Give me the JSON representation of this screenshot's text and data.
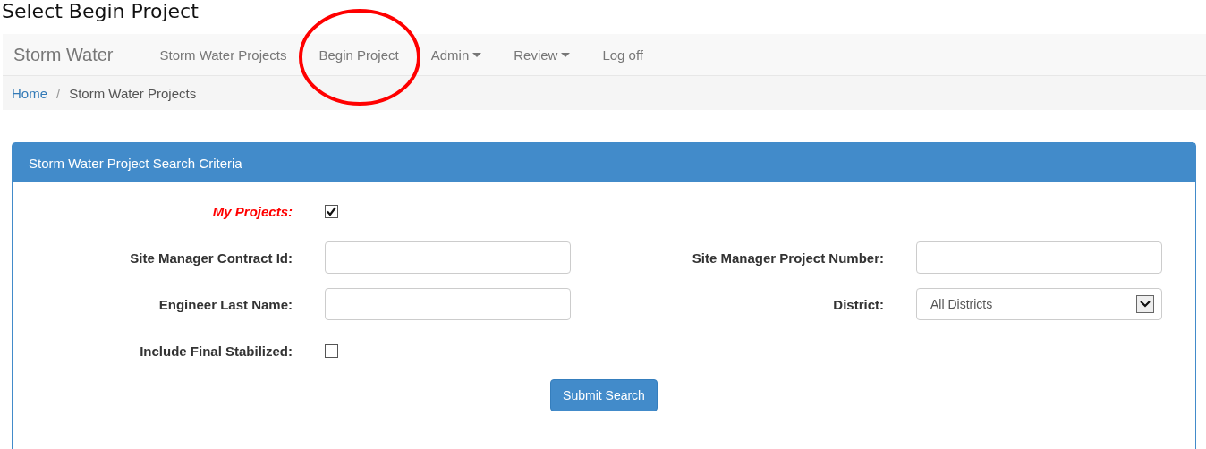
{
  "caption": "Select Begin Project",
  "navbar": {
    "brand": "Storm Water",
    "items": [
      {
        "label": "Storm Water Projects",
        "dropdown": false,
        "circled": false
      },
      {
        "label": "Begin Project",
        "dropdown": false,
        "circled": true
      },
      {
        "label": "Admin",
        "dropdown": true,
        "circled": false
      },
      {
        "label": "Review",
        "dropdown": true,
        "circled": false
      },
      {
        "label": "Log off",
        "dropdown": false,
        "circled": false
      }
    ]
  },
  "breadcrumb": {
    "separator": "/",
    "items": [
      {
        "label": "Home",
        "kind": "link"
      },
      {
        "label": "Storm Water Projects",
        "kind": "current"
      }
    ]
  },
  "panel": {
    "title": "Storm Water Project Search Criteria",
    "fields": [
      {
        "label": "My Projects:",
        "kind": "checkbox",
        "checked": true,
        "highlighted": true
      },
      {
        "label": "Site Manager Contract Id:",
        "kind": "text"
      },
      {
        "label": "Site Manager Project Number:",
        "kind": "text"
      },
      {
        "label": "Engineer Last Name:",
        "kind": "text"
      },
      {
        "label": "District:",
        "kind": "select",
        "value": "All Districts"
      },
      {
        "label": "Include Final Stabilized:",
        "kind": "checkbox",
        "checked": false,
        "highlighted": false
      }
    ],
    "submit": "Submit Search"
  }
}
